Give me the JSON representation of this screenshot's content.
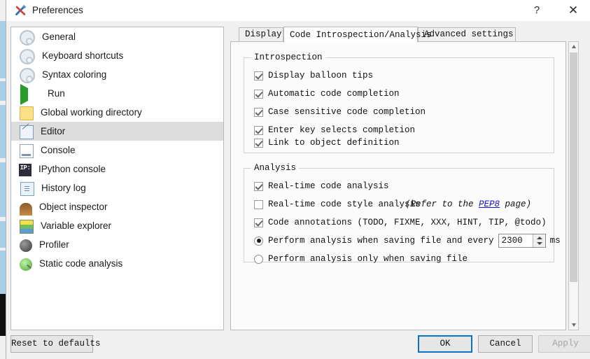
{
  "window": {
    "title": "Preferences",
    "icon": "tools-icon",
    "help_label": "?",
    "close_label": "✕"
  },
  "sidebar": {
    "items": [
      {
        "label": "General",
        "icon": "gear-icon",
        "selected": false
      },
      {
        "label": "Keyboard shortcuts",
        "icon": "gear-icon",
        "selected": false
      },
      {
        "label": "Syntax coloring",
        "icon": "gear-icon",
        "selected": false
      },
      {
        "label": "Run",
        "icon": "play-icon",
        "selected": false
      },
      {
        "label": "Global working directory",
        "icon": "folder-icon",
        "selected": false
      },
      {
        "label": "Editor",
        "icon": "editor-icon",
        "selected": true
      },
      {
        "label": "Console",
        "icon": "console-icon",
        "selected": false
      },
      {
        "label": "IPython console",
        "icon": "ipython-icon",
        "selected": false
      },
      {
        "label": "History log",
        "icon": "history-icon",
        "selected": false
      },
      {
        "label": "Object inspector",
        "icon": "object-inspector-icon",
        "selected": false
      },
      {
        "label": "Variable explorer",
        "icon": "variable-explorer-icon",
        "selected": false
      },
      {
        "label": "Profiler",
        "icon": "profiler-icon",
        "selected": false
      },
      {
        "label": "Static code analysis",
        "icon": "pylint-icon",
        "selected": false
      }
    ]
  },
  "tabs": [
    {
      "label": "Display",
      "active": false
    },
    {
      "label": "Code Introspection/Analysis",
      "active": true
    },
    {
      "label": "Advanced settings",
      "active": false
    }
  ],
  "introspection": {
    "title": "Introspection",
    "options": [
      {
        "label": "Display balloon tips",
        "checked": true
      },
      {
        "label": "Automatic code completion",
        "checked": true
      },
      {
        "label": "Case sensitive code completion",
        "checked": true
      },
      {
        "label": "Enter key selects completion",
        "checked": true
      },
      {
        "label": "Link to object definition",
        "checked": true
      }
    ]
  },
  "analysis": {
    "title": "Analysis",
    "checkboxes": [
      {
        "label": "Real-time code analysis",
        "checked": true
      },
      {
        "label": "Real-time code style analysis",
        "checked": false
      },
      {
        "label": "Code annotations (TODO, FIXME, XXX, HINT, TIP, @todo)",
        "checked": true
      }
    ],
    "pep8_note": {
      "prefix": "(Refer to the ",
      "link": "PEP8",
      "suffix": " page)"
    },
    "radios": [
      {
        "label": "Perform analysis when saving file and every",
        "selected": true
      },
      {
        "label": "Perform analysis only when saving file",
        "selected": false
      }
    ],
    "interval_value": "2300",
    "interval_unit": "ms"
  },
  "buttons": {
    "reset": "Reset to defaults",
    "ok": "OK",
    "cancel": "Cancel",
    "apply": "Apply"
  },
  "colors": {
    "accent": "#0a72c7",
    "link": "#1414cc",
    "selected_row": "#dcdcdc",
    "disabled_text": "#a6a6a6"
  }
}
